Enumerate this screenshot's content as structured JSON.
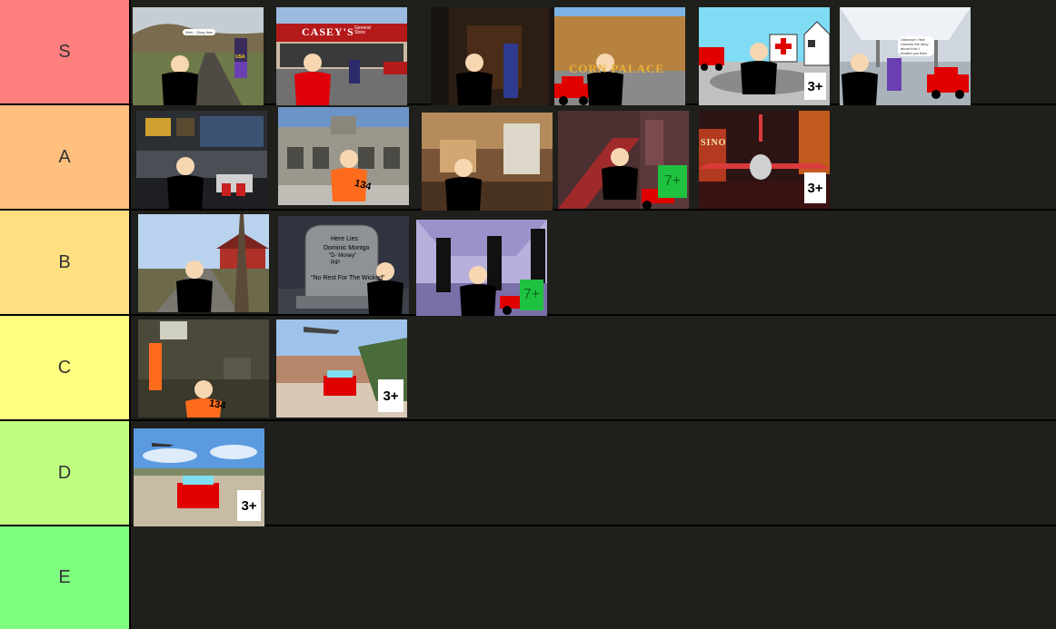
{
  "tiers": [
    {
      "label": "S",
      "color": "#ff7f7f"
    },
    {
      "label": "A",
      "color": "#ffbf7f"
    },
    {
      "label": "B",
      "color": "#ffdf7f"
    },
    {
      "label": "C",
      "color": "#ffff7f"
    },
    {
      "label": "D",
      "color": "#bfff7f"
    },
    {
      "label": "E",
      "color": "#7fff7f"
    }
  ],
  "tiles": {
    "s1": {
      "bubble": "Well... Okay then",
      "shirt": "USA"
    },
    "s2": {
      "sign_main": "CASEY'S",
      "sign_sub": "General Store"
    },
    "s3": {
      "sign": "CORN PALACE"
    },
    "s4": {
      "badge": "3+"
    },
    "s5": {
      "bubble": "Unknown: Hey! Unlocks the story about how I treated you then."
    },
    "a2": {
      "jersey": "134"
    },
    "a4": {
      "badge": "7+"
    },
    "a5": {
      "sign": "SINO",
      "badge": "3+"
    },
    "b2": {
      "line1": "Here Lies",
      "line2": "Dominic Montgo",
      "line3": "\"D- Money\"",
      "line4": "RIP",
      "line5": "\"No Rest For The Wicked\""
    },
    "b3": {
      "badge": "7+"
    },
    "c1": {
      "jersey": "134"
    },
    "c2": {
      "badge": "3+"
    },
    "d1": {
      "badge": "3+"
    }
  }
}
